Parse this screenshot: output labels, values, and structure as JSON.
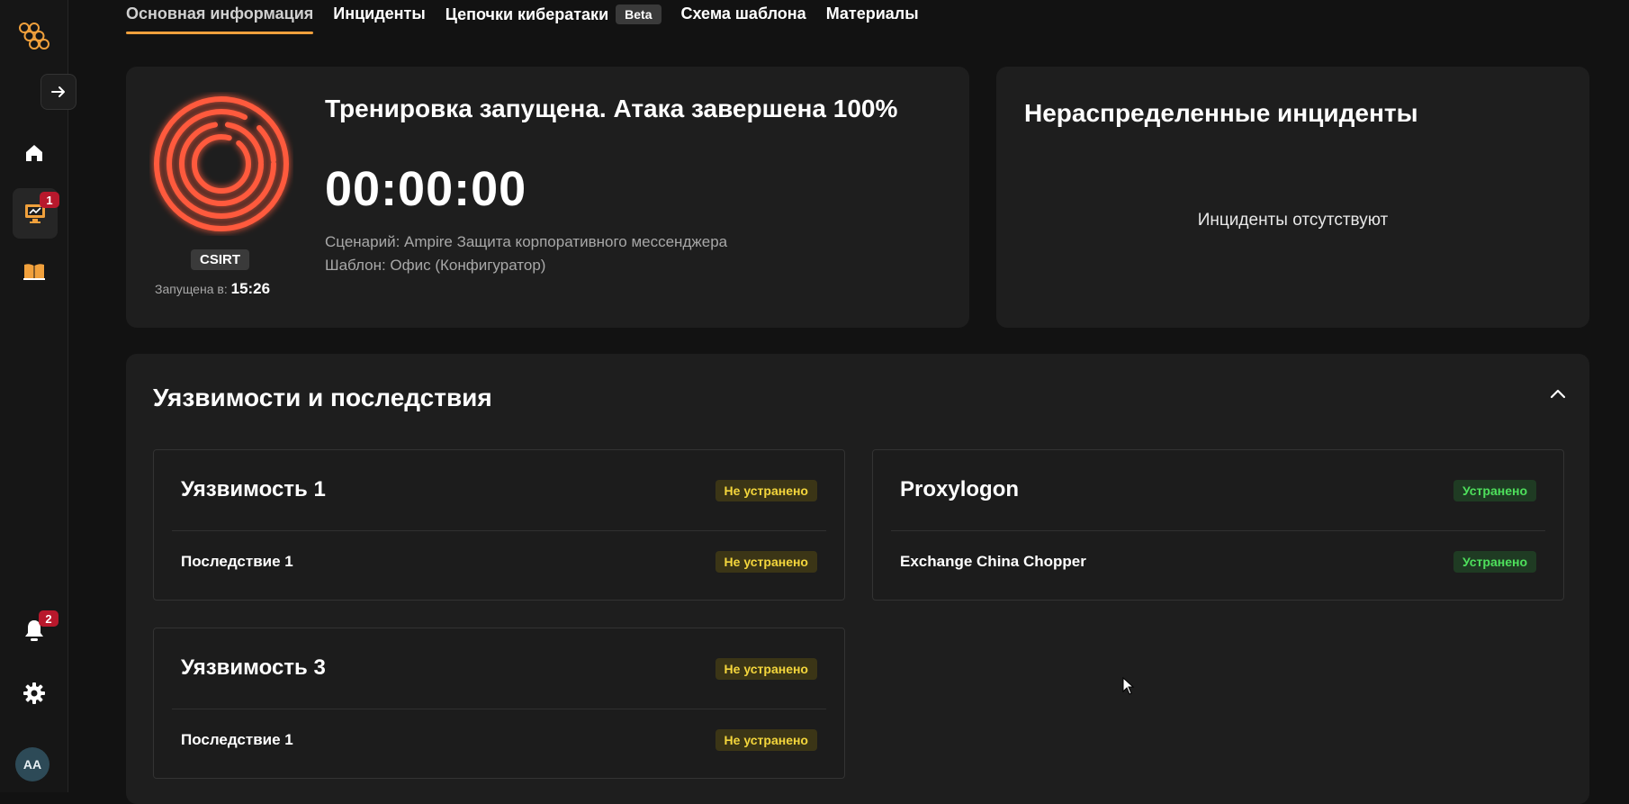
{
  "tabs": [
    {
      "label": "Основная информация",
      "active": true
    },
    {
      "label": "Инциденты"
    },
    {
      "label": "Цепочки кибератаки",
      "badge": "Beta"
    },
    {
      "label": "Схема шаблона"
    },
    {
      "label": "Материалы"
    }
  ],
  "sidebar": {
    "icons": [
      "logo-icon",
      "arrow-right-icon",
      "home-icon",
      "monitor-icon",
      "book-icon",
      "bell-icon",
      "gear-icon"
    ],
    "monitor_badge": "1",
    "bell_badge": "2",
    "avatar_initials": "AA"
  },
  "training": {
    "title": "Тренировка запущена. Атака завершена 100%",
    "timer": "00:00:00",
    "scenario": "Сценарий: Ampire Защита корпоративного мессенджера",
    "template": "Шаблон: Офис (Конфигуратор)",
    "team": "CSIRT",
    "started_label": "Запущена в:",
    "started_time": "15:26"
  },
  "unassigned": {
    "title": "Нераспределенные инциденты",
    "empty_text": "Инциденты отсутствуют"
  },
  "vulnerabilities": {
    "title": "Уязвимости и последствия",
    "items": [
      {
        "title": "Уязвимость 1",
        "status": "Не устранено",
        "consequence": "Последствие 1",
        "consequence_status": "Не устранено"
      },
      {
        "title": "Proxylogon",
        "status": "Устранено",
        "consequence": "Exchange China Chopper",
        "consequence_status": "Устранено"
      },
      {
        "title": "Уязвимость 3",
        "status": "Не устранено",
        "consequence": "Последствие 1",
        "consequence_status": "Не устранено"
      }
    ]
  },
  "colors": {
    "accent": "#f0a03c",
    "not_fixed": "#f4d63c",
    "fixed": "#4ee05c",
    "badge": "#b8182c",
    "target_ring": "#ff5a3c"
  }
}
